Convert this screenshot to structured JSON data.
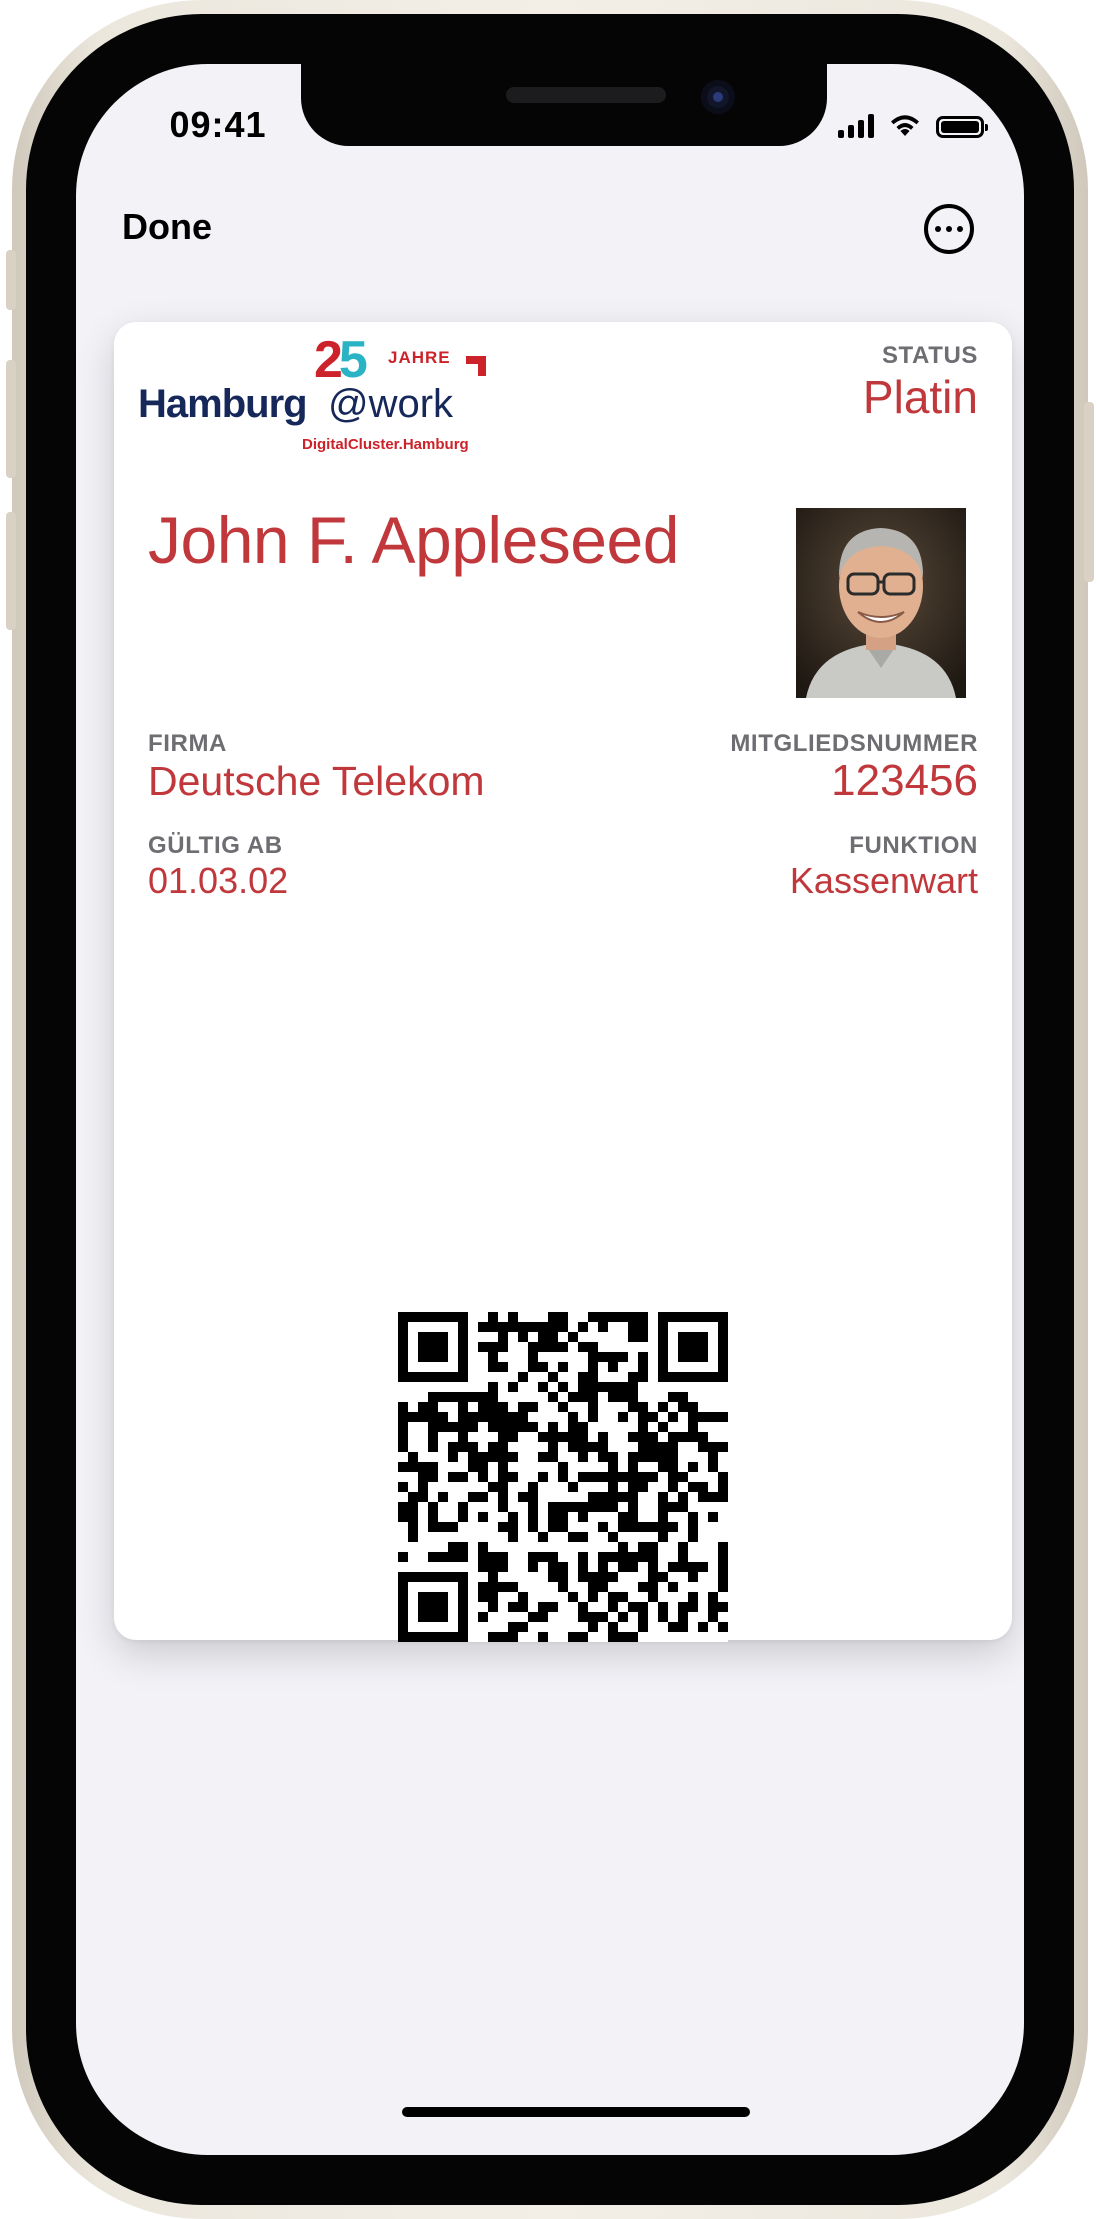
{
  "status_bar": {
    "time": "09:41",
    "signal_icon": "cellular-signal-icon",
    "wifi_icon": "wifi-icon",
    "battery_icon": "battery-icon"
  },
  "nav": {
    "done_label": "Done",
    "more_icon": "ellipsis-circle-icon"
  },
  "pass": {
    "logo": {
      "anniversary_digit_1": "2",
      "anniversary_digit_2": "5",
      "anniversary_word": "JAHRE",
      "brand_name": "Hamburg",
      "brand_suffix": "@work",
      "tagline": "DigitalCluster.Hamburg"
    },
    "status": {
      "label": "STATUS",
      "value": "Platin"
    },
    "member_name": "John F. Appleseed",
    "firma": {
      "label": "FIRMA",
      "value": "Deutsche Telekom"
    },
    "mitgliedsnummer": {
      "label": "MITGLIEDSNUMMER",
      "value": "123456"
    },
    "gueltig_ab": {
      "label": "GÜLTIG AB",
      "value": "01.03.02"
    },
    "funktion": {
      "label": "FUNKTION",
      "value": "Kassenwart"
    },
    "barcode_type": "qr-code",
    "accent_color": "#c0383b",
    "label_color": "#6d6d72",
    "brand_navy": "#16275a"
  }
}
